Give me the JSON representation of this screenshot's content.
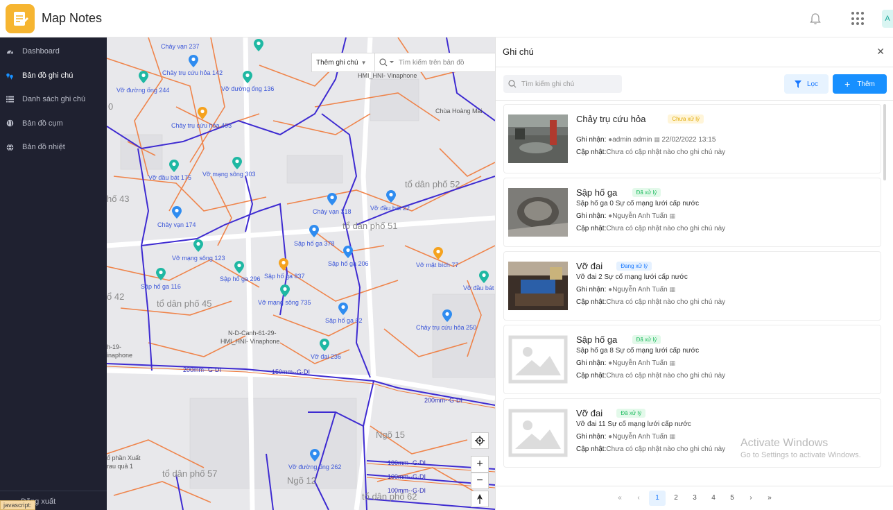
{
  "app": {
    "title": "Map Notes",
    "avatar_initial": "A"
  },
  "sidebar": {
    "items": [
      {
        "label": "Dashboard",
        "icon": "speedometer-icon"
      },
      {
        "label": "Bản đồ ghi chú",
        "icon": "map-pins-icon",
        "active": true
      },
      {
        "label": "Danh sách ghi chú",
        "icon": "list-icon"
      },
      {
        "label": "Bản đồ cụm",
        "icon": "globe-icon"
      },
      {
        "label": "Bản đồ nhiệt",
        "icon": "world-icon"
      }
    ],
    "logout_label": "Đăng xuất",
    "status_text": "javascript:"
  },
  "map": {
    "add_note_select": "Thêm ghi chú",
    "search_placeholder": "Tìm kiếm trên bản đồ",
    "markers": [
      {
        "label": "Chảy vạn 237",
        "color": "teal"
      },
      {
        "label": "Chảy trụ cứu hỏa 142",
        "color": "blue"
      },
      {
        "label": "Vỡ đường ống 244",
        "color": "teal"
      },
      {
        "label": "Vỡ đường ống 136",
        "color": "teal"
      },
      {
        "label": "Chảy trụ cứu hỏa 493",
        "color": "orange"
      },
      {
        "label": "Vỡ đầu bát 175",
        "color": "teal"
      },
      {
        "label": "Vỡ mạng sông 303",
        "color": "teal"
      },
      {
        "label": "Chảy vạn 318",
        "color": "blue"
      },
      {
        "label": "Vỡ đầu bát 22",
        "color": "blue"
      },
      {
        "label": "Chảy vạn 174",
        "color": "blue"
      },
      {
        "label": "Sập hố ga 378",
        "color": "blue"
      },
      {
        "label": "Vỡ mạng sông 123",
        "color": "teal"
      },
      {
        "label": "Sập hố ga 206",
        "color": "blue"
      },
      {
        "label": "Vỡ mặt bích 77",
        "color": "orange"
      },
      {
        "label": "Sập hố ga 116",
        "color": "teal"
      },
      {
        "label": "Sập hố ga 296",
        "color": "teal"
      },
      {
        "label": "Sập hố ga 837",
        "color": "orange"
      },
      {
        "label": "Vỡ đầu bát",
        "color": "teal"
      },
      {
        "label": "Vỡ mạng sông 735",
        "color": "teal"
      },
      {
        "label": "Sập hố ga 62",
        "color": "blue"
      },
      {
        "label": "Chảy trụ cứu hỏa 250",
        "color": "blue"
      },
      {
        "label": "Vỡ đai 236",
        "color": "teal"
      },
      {
        "label": "Vỡ đường ống 262",
        "color": "blue"
      }
    ],
    "place_labels": [
      {
        "text": "HMI_HNI- Vinaphone",
        "kind": "small"
      },
      {
        "text": "Chùa Hoàng Mai",
        "kind": "small"
      },
      {
        "text": "N-D-Canh-61-29-",
        "kind": "small"
      },
      {
        "text": "HMI_HNI- Vinaphone",
        "kind": "small"
      },
      {
        "text": "h-19-",
        "kind": "small"
      },
      {
        "text": "inaphone",
        "kind": "small"
      },
      {
        "text": "ổ phần Xuất",
        "kind": "small"
      },
      {
        "text": "rau quả 1",
        "kind": "small"
      },
      {
        "text": "0",
        "kind": "street"
      },
      {
        "text": "tổ dân phố 52",
        "kind": "street"
      },
      {
        "text": "hố 43",
        "kind": "street"
      },
      {
        "text": "tổ dân phố 51",
        "kind": "street"
      },
      {
        "text": "ổ 42",
        "kind": "street"
      },
      {
        "text": "tổ dân phố 45",
        "kind": "street"
      },
      {
        "text": "Ngõ 15",
        "kind": "street"
      },
      {
        "text": "tổ dân phố 57",
        "kind": "street"
      },
      {
        "text": "Ngõ 12",
        "kind": "street"
      },
      {
        "text": "tổ dân phố 62",
        "kind": "street"
      },
      {
        "text": "200mm-·G·DI",
        "kind": "pipe"
      },
      {
        "text": "150mm-·G·DI",
        "kind": "pipe"
      },
      {
        "text": "200mm-·G·DI",
        "kind": "pipe"
      },
      {
        "text": "100mm-·G·DI",
        "kind": "pipe"
      },
      {
        "text": "100mm-·G·DI",
        "kind": "pipe"
      },
      {
        "text": "100mm-·G·DI",
        "kind": "pipe"
      }
    ]
  },
  "panel": {
    "title": "Ghi chú",
    "search_placeholder": "Tìm kiếm ghi chú",
    "filter_label": "Lọc",
    "add_label": "Thêm",
    "field_labels": {
      "recorded": "Ghi nhận:",
      "updated": "Cập nhật:"
    },
    "notes": [
      {
        "title": "Chảy trụ cứu hỏa",
        "status": "Chưa xử lý",
        "status_kind": "pending",
        "subtitle": "",
        "recorder": "admin admin",
        "date": "22/02/2022 13:15",
        "update": "Chưa có cập nhật nào cho ghi chú này",
        "image": "street"
      },
      {
        "title": "Sập hố ga",
        "status": "Đã xử lý",
        "status_kind": "done",
        "subtitle": "Sập hố ga 0   Sự cố mạng lưới cấp nước",
        "recorder": "Nguyễn Anh Tuấn",
        "date": "",
        "update": "Chưa có cập nhật nào cho ghi chú này",
        "image": "manhole"
      },
      {
        "title": "Vỡ đai",
        "status": "Đang xử lý",
        "status_kind": "progress",
        "subtitle": "Vỡ đai 2   Sự cố mạng lưới cấp nước",
        "recorder": "Nguyễn Anh Tuấn",
        "date": "",
        "update": "Chưa có cập nhật nào cho ghi chú này",
        "image": "pipe"
      },
      {
        "title": "Sập hố ga",
        "status": "Đã xử lý",
        "status_kind": "done",
        "subtitle": "Sập hố ga 8   Sự cố mạng lưới cấp nước",
        "recorder": "Nguyễn Anh Tuấn",
        "date": "",
        "update": "Chưa có cập nhật nào cho ghi chú này",
        "image": "placeholder"
      },
      {
        "title": "Vỡ đai",
        "status": "Đã xử lý",
        "status_kind": "done",
        "subtitle": "Vỡ đai 11   Sự cố mạng lưới cấp nước",
        "recorder": "Nguyễn Anh Tuấn",
        "date": "",
        "update": "Chưa có cập nhật nào cho ghi chú này",
        "image": "placeholder"
      }
    ],
    "pagination": {
      "pages": [
        "1",
        "2",
        "3",
        "4",
        "5"
      ],
      "current": "1",
      "first": "«",
      "prev": "‹",
      "next": "›",
      "last": "»"
    }
  },
  "watermark": {
    "line1": "Activate Windows",
    "line2": "Go to Settings to activate Windows."
  }
}
